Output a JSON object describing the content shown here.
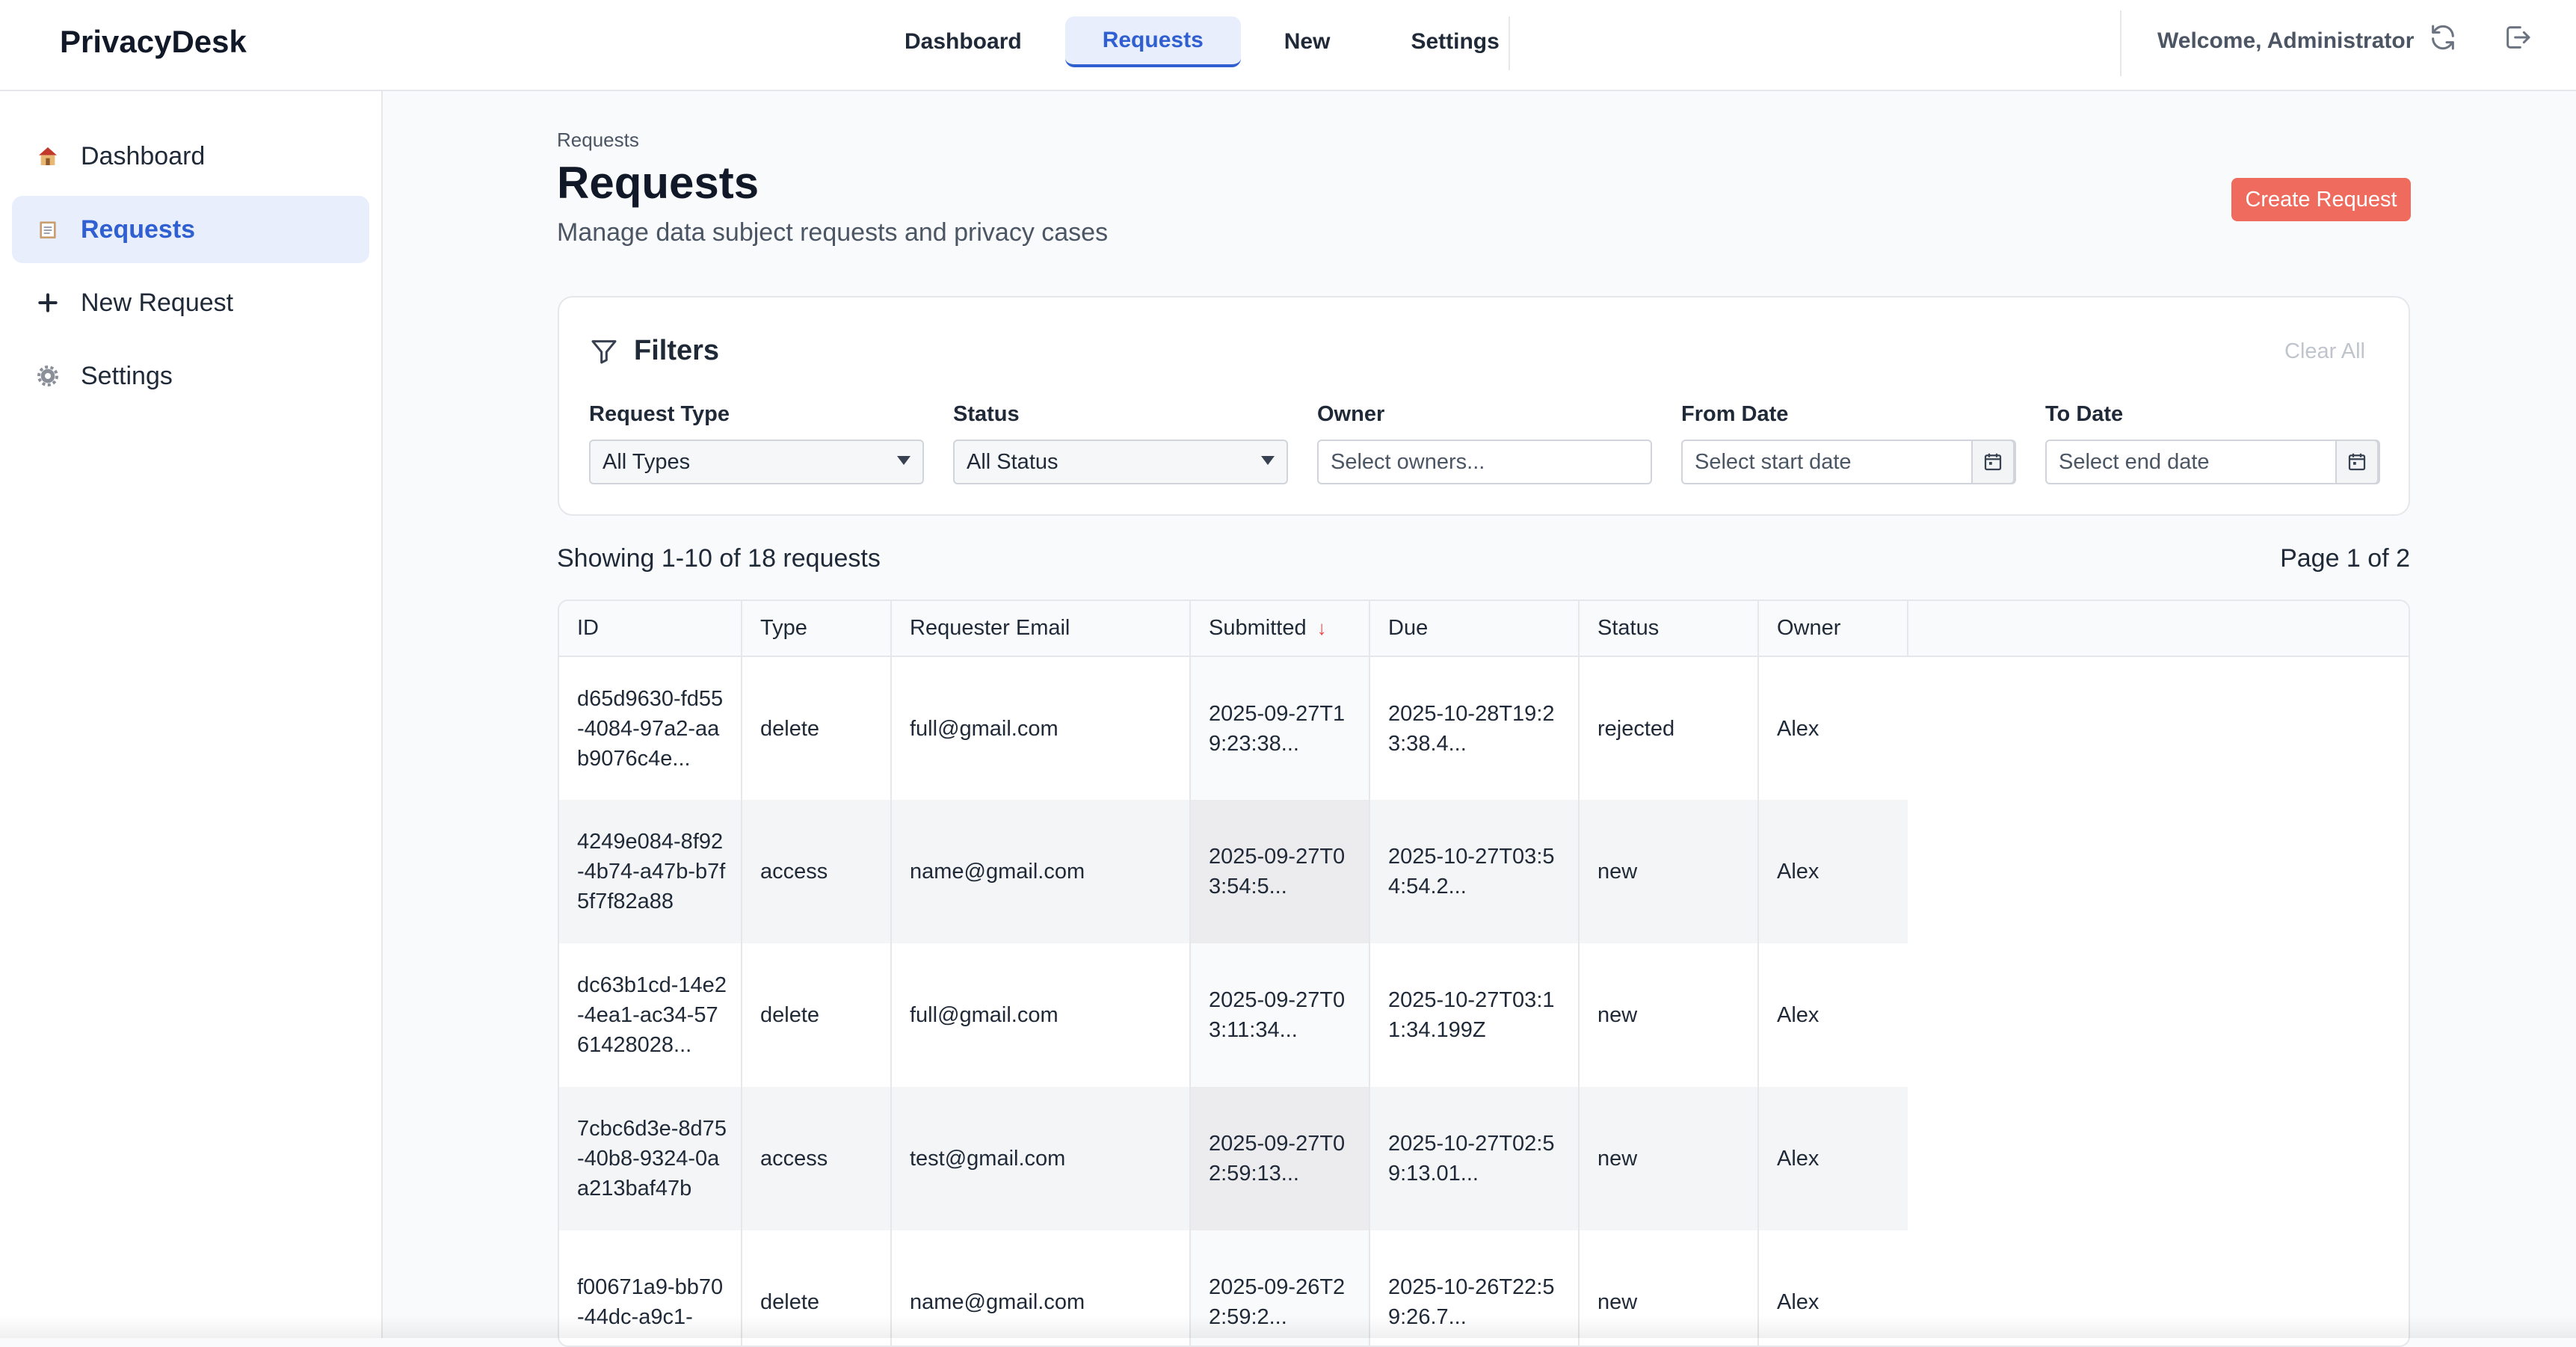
{
  "app": {
    "brand": "PrivacyDesk",
    "welcome": "Welcome, Administrator"
  },
  "topnav": [
    {
      "label": "Dashboard",
      "active": false
    },
    {
      "label": "Requests",
      "active": true
    },
    {
      "label": "New",
      "active": false
    },
    {
      "label": "Settings",
      "active": false
    }
  ],
  "sidebar": [
    {
      "label": "Dashboard",
      "icon": "house-icon",
      "active": false
    },
    {
      "label": "Requests",
      "icon": "clipboard-icon",
      "active": true
    },
    {
      "label": "New Request",
      "icon": "plus-icon",
      "active": false
    },
    {
      "label": "Settings",
      "icon": "gear-icon",
      "active": false
    }
  ],
  "page": {
    "breadcrumb": "Requests",
    "title": "Requests",
    "subtitle": "Manage data subject requests and privacy cases",
    "create_label": "Create Request"
  },
  "filters": {
    "title": "Filters",
    "clear_label": "Clear All",
    "request_type": {
      "label": "Request Type",
      "value": "All Types"
    },
    "status": {
      "label": "Status",
      "value": "All Status"
    },
    "owner": {
      "label": "Owner",
      "placeholder": "Select owners..."
    },
    "from_date": {
      "label": "From Date",
      "placeholder": "Select start date"
    },
    "to_date": {
      "label": "To Date",
      "placeholder": "Select end date"
    }
  },
  "summary": {
    "showing": "Showing 1-10 of 18 requests",
    "page": "Page 1 of 2"
  },
  "table": {
    "headers": [
      "ID",
      "Type",
      "Requester Email",
      "Submitted",
      "Due",
      "Status",
      "Owner"
    ],
    "rows": [
      {
        "id": "d65d9630-fd55-4084-97a2-aab9076c4e...",
        "type": "delete",
        "email": "full@gmail.com",
        "submitted": "2025-09-27T19:23:38...",
        "due": "2025-10-28T19:23:38.4...",
        "status": "rejected",
        "owner": "Alex"
      },
      {
        "id": "4249e084-8f92-4b74-a47b-b7f5f7f82a88",
        "type": "access",
        "email": "name@gmail.com",
        "submitted": "2025-09-27T03:54:5...",
        "due": "2025-10-27T03:54:54.2...",
        "status": "new",
        "owner": "Alex"
      },
      {
        "id": "dc63b1cd-14e2-4ea1-ac34-5761428028...",
        "type": "delete",
        "email": "full@gmail.com",
        "submitted": "2025-09-27T03:11:34...",
        "due": "2025-10-27T03:11:34.199Z",
        "status": "new",
        "owner": "Alex"
      },
      {
        "id": "7cbc6d3e-8d75-40b8-9324-0aa213baf47b",
        "type": "access",
        "email": "test@gmail.com",
        "submitted": "2025-09-27T02:59:13...",
        "due": "2025-10-27T02:59:13.01...",
        "status": "new",
        "owner": "Alex"
      },
      {
        "id": "f00671a9-bb70-44dc-a9c1-",
        "type": "delete",
        "email": "name@gmail.com",
        "submitted": "2025-09-26T22:59:2...",
        "due": "2025-10-26T22:59:26.7...",
        "status": "new",
        "owner": "Alex"
      }
    ]
  }
}
